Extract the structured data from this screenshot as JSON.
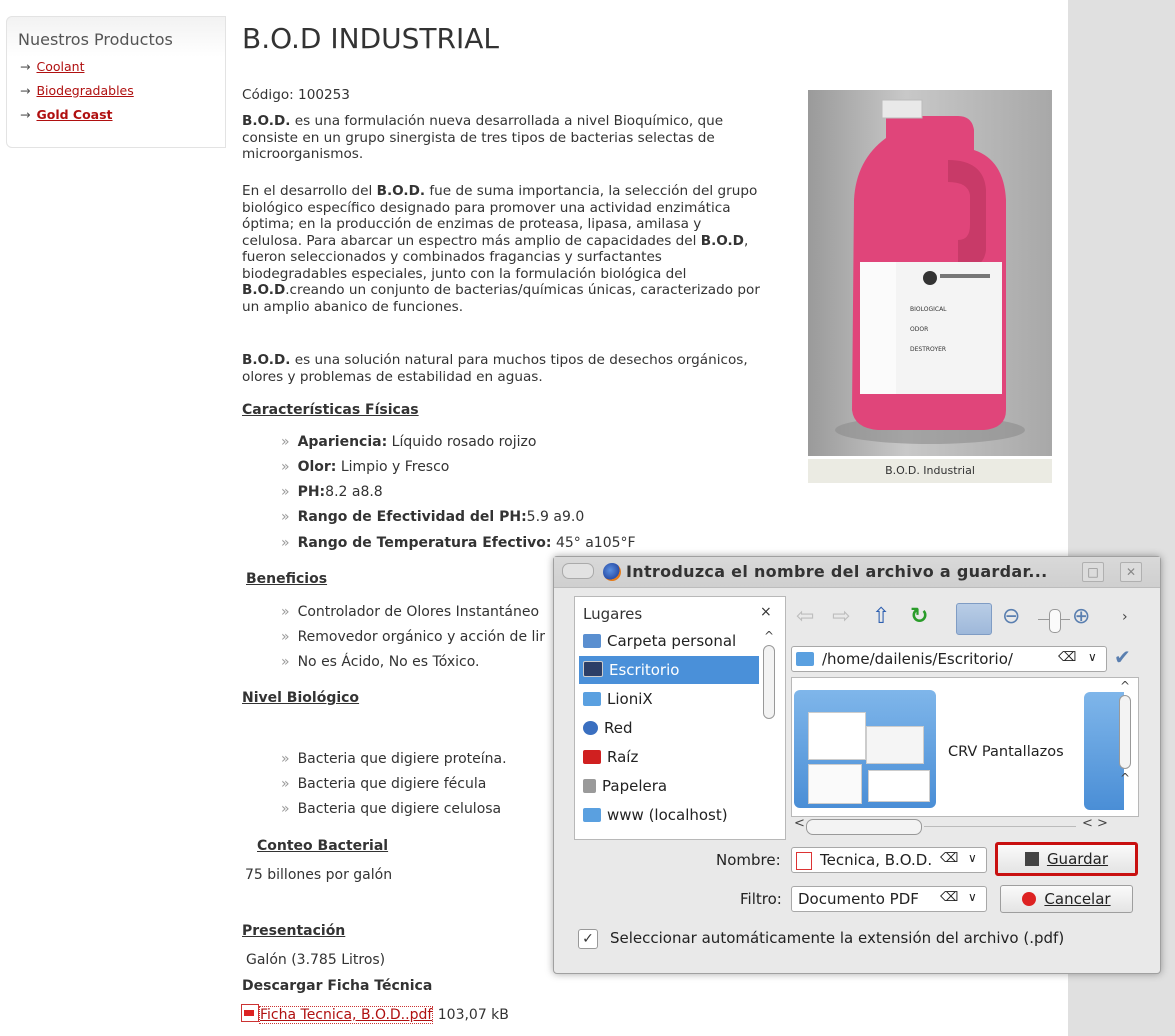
{
  "sidebar": {
    "title": "Nuestros Productos",
    "links": [
      {
        "label": "Coolant"
      },
      {
        "label": "Biodegradables"
      },
      {
        "label": "Gold Coast"
      }
    ],
    "arrow": "→"
  },
  "product": {
    "title": "B.O.D INDUSTRIAL",
    "code": "Código: 100253",
    "p1_bold": "B.O.D.",
    "p1_lines": [
      " es una formulación nueva desarrollada a nivel Bioquímico, que",
      "consiste en un grupo sinergista de tres tipos de bacterias selectas de",
      "microorganismos."
    ],
    "p2_lines": [
      [
        "En el desarrollo del ",
        "B.O.D.",
        " fue de suma importancia,  la selección del grupo"
      ],
      [
        "biológico específico designado para promover una actividad enzimática",
        "",
        ""
      ],
      [
        "óptima; en la producción de enzimas de proteasa, lipasa, amilasa y",
        "",
        ""
      ],
      [
        "celulosa.  Para abarcar un espectro más amplio de capacidades del ",
        "B.O.D",
        ","
      ],
      [
        "fueron seleccionados y combinados fragancias y surfactantes",
        "",
        ""
      ],
      [
        "biodegradables especiales, junto con la formulación biológica del",
        "",
        ""
      ],
      [
        "",
        "B.O.D",
        ".creando un conjunto de bacterias/químicas únicas, caracterizado por"
      ],
      [
        "un amplio abanico de funciones.",
        "",
        ""
      ]
    ],
    "p3_bold": "B.O.D.",
    "p3_lines": [
      " es una solución natural para muchos tipos de desechos orgánicos,",
      "olores y problemas de estabilidad en aguas."
    ],
    "image_caption": "B.O.D. Industrial",
    "label_line1": "BIOLOGICAL",
    "label_line2": "ODOR",
    "label_line3": "DESTROYER",
    "bullet_mark": "»",
    "sections": {
      "caracteristicas": {
        "heading": "Características Físicas",
        "items": [
          {
            "bold": "Apariencia:",
            "text": " Líquido rosado rojizo"
          },
          {
            "bold": "Olor:",
            "text": " Limpio y Fresco"
          },
          {
            "bold": "PH:",
            "text": "8.2 a8.8"
          },
          {
            "bold": "Rango de Efectividad del PH:",
            "text": "5.9 a9.0"
          },
          {
            "bold": "Rango de Temperatura Efectivo:",
            "text": " 45° a105°F"
          }
        ]
      },
      "beneficios": {
        "heading": "Beneficios",
        "items": [
          "Controlador de Olores Instantáneo",
          "Removedor orgánico y acción de lir",
          "No es Ácido, No es Tóxico."
        ]
      },
      "nivel": {
        "heading": "Nivel Biológico",
        "items": [
          "Bacteria que digiere proteína.",
          "Bacteria que digiere fécula",
          "Bacteria que digiere celulosa"
        ]
      },
      "conteo": {
        "heading": "Conteo Bacterial",
        "text": "75 billones por galón"
      },
      "presentacion": {
        "heading": "Presentación",
        "text": "Galón (3.785 Litros)"
      },
      "descarga": {
        "heading": "Descargar Ficha Técnica",
        "link": "Ficha Tecnica, B.O.D..pdf",
        "size": "103,07 kB"
      }
    }
  },
  "dialog": {
    "title": "Introduzca el nombre del archivo a guardar...",
    "places_header": "Lugares",
    "close_glyph": "×",
    "places": [
      {
        "label": "Carpeta personal",
        "color": "#5a8fd0"
      },
      {
        "label": "Escritorio",
        "color": "#2c3e66"
      },
      {
        "label": "LioniX",
        "color": "#5aa0e0"
      },
      {
        "label": "Red",
        "color": "#3a6fc0"
      },
      {
        "label": "Raíz",
        "color": "#d02020"
      },
      {
        "label": "Papelera",
        "color": "#9a9a9a"
      },
      {
        "label": "www (localhost)",
        "color": "#5aa0e0"
      }
    ],
    "path": "/home/dailenis/Escritorio/",
    "folder_name": "CRV Pantallazos",
    "nombre_label": "Nombre:",
    "nombre_value": "Tecnica, B.O.D.",
    "filtro_label": "Filtro:",
    "filtro_value": "Documento PDF",
    "save_label": "Guardar",
    "cancel_label": "Cancelar",
    "auto_ext_label": "Seleccionar automáticamente la extensión del archivo (.pdf)",
    "auto_ext_checked": true
  }
}
